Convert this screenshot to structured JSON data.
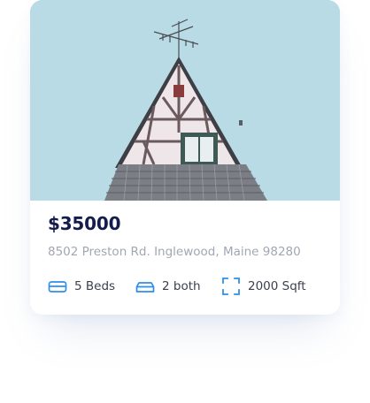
{
  "listing": {
    "image_alt": "Tudor style house rooftop against blue sky",
    "price": "$35000",
    "address": "8502 Preston Rd. Inglewood, Maine 98280",
    "features": [
      {
        "icon": "bed-icon",
        "label": "5 Beds"
      },
      {
        "icon": "bath-icon",
        "label": "2 both"
      },
      {
        "icon": "area-frame-icon",
        "label": "2000 Sqft"
      }
    ]
  },
  "colors": {
    "accent": "#2f8fe8",
    "price_text": "#141b4d",
    "address_text": "#a2a7b3",
    "feature_text": "#3b3f4e",
    "sky": "#b9dbe6"
  }
}
